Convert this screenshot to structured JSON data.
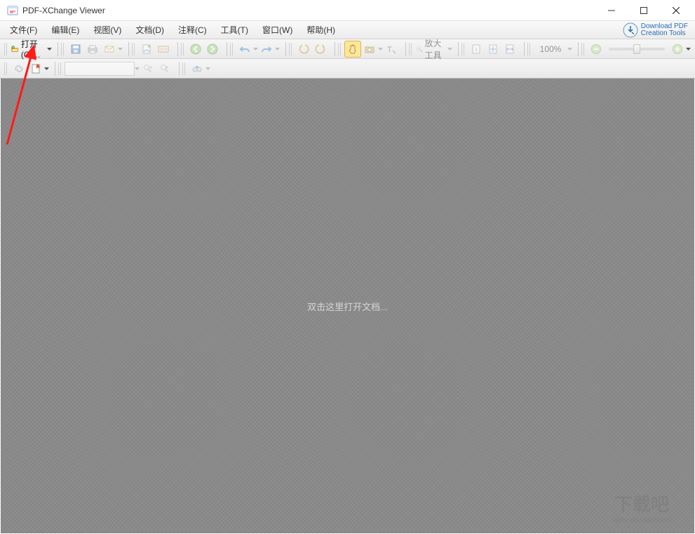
{
  "titlebar": {
    "title": "PDF-XChange Viewer"
  },
  "menu": {
    "file": "文件(F)",
    "edit": "编辑(E)",
    "view": "视图(V)",
    "document": "文档(D)",
    "annotate": "注释(C)",
    "tools": "工具(T)",
    "window": "窗口(W)",
    "help": "帮助(H)",
    "download_line1": "Download PDF",
    "download_line2": "Creation Tools"
  },
  "tb": {
    "open": "打开(O)...",
    "zoom_tool": "放大工具",
    "zoom_pct": "100%"
  },
  "content": {
    "hint": "双击这里打开文档..."
  },
  "watermark": {
    "text": "下载吧",
    "url": "www.xiazaiba.com"
  }
}
